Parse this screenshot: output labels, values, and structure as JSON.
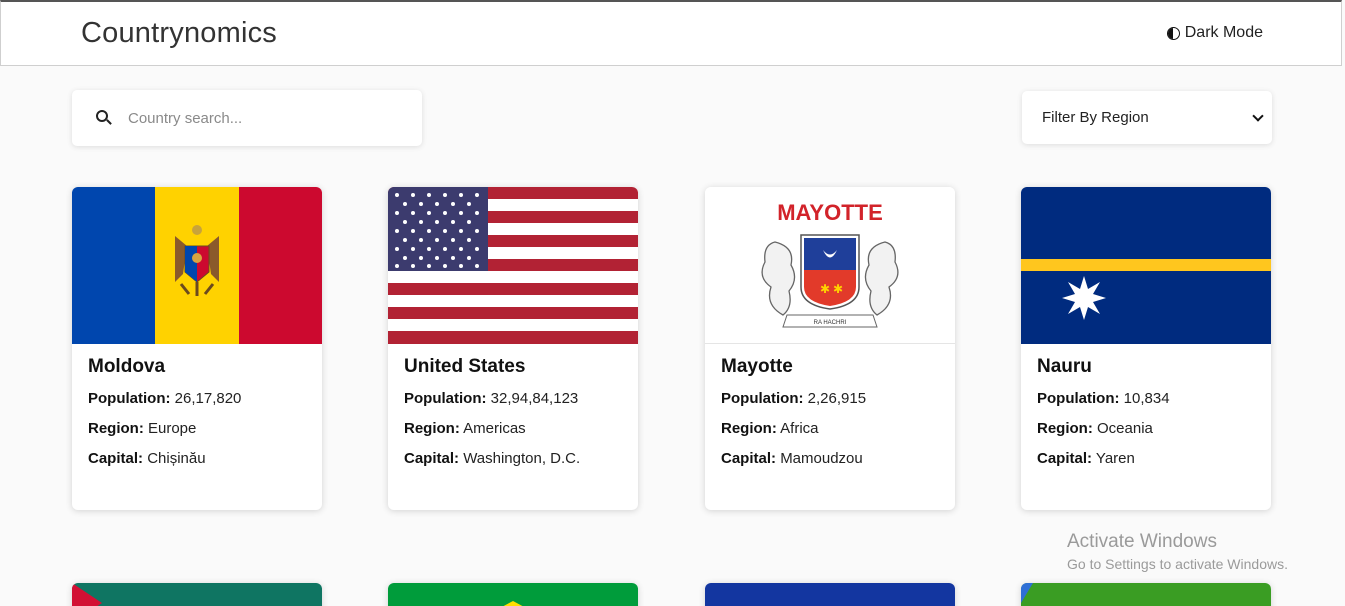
{
  "header": {
    "title": "Countrynomics",
    "theme_toggle_label": "Dark Mode"
  },
  "search": {
    "placeholder": "Country search..."
  },
  "filter": {
    "label": "Filter By Region"
  },
  "field_labels": {
    "population": "Population:",
    "region": "Region:",
    "capital": "Capital:"
  },
  "cards": [
    {
      "name": "Moldova",
      "population": "26,17,820",
      "region": "Europe",
      "capital": "Chișinău"
    },
    {
      "name": "United States",
      "population": "32,94,84,123",
      "region": "Americas",
      "capital": "Washington, D.C."
    },
    {
      "name": "Mayotte",
      "population": "2,26,915",
      "region": "Africa",
      "capital": "Mamoudzou",
      "flag_text": "MAYOTTE",
      "ribbon_text": "RA HACHRI"
    },
    {
      "name": "Nauru",
      "population": "10,834",
      "region": "Oceania",
      "capital": "Yaren"
    }
  ],
  "watermark": {
    "title": "Activate Windows",
    "subtitle": "Go to Settings to activate Windows."
  },
  "colors": {
    "background": "#fafafa",
    "card": "#ffffff",
    "text": "#111111"
  }
}
